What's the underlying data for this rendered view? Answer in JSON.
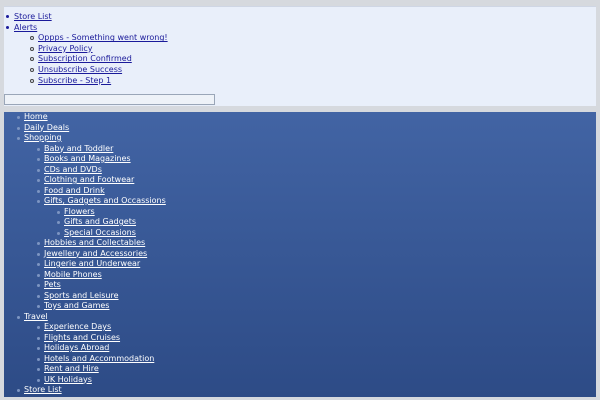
{
  "top_menu": {
    "items": [
      {
        "label": "Store List"
      },
      {
        "label": "Alerts",
        "children": [
          {
            "label": "Oppps - Something went wrong!"
          },
          {
            "label": "Privacy Policy"
          },
          {
            "label": "Subscription Confirmed"
          },
          {
            "label": "Unsubscribe Success"
          },
          {
            "label": "Subscribe - Step 1"
          }
        ]
      }
    ]
  },
  "search": {
    "value": "",
    "placeholder": ""
  },
  "nav": {
    "home": "Home",
    "daily_deals": "Daily Deals",
    "shopping": {
      "label": "Shopping",
      "items": [
        "Baby and Toddler",
        "Books and Magazines",
        "CDs and DVDs",
        "Clothing and Footwear",
        "Food and Drink",
        "Gifts, Gadgets and Occassions",
        "Hobbies and Collectables",
        "Jewellery and Accessories",
        "Lingerie and Underwear",
        "Mobile Phones",
        "Pets",
        "Sports and Leisure",
        "Toys and Games"
      ],
      "gifts_children": [
        "Flowers",
        "Gifts and Gadgets",
        "Special Occasions"
      ]
    },
    "travel": {
      "label": "Travel",
      "items": [
        "Experience Days",
        "Flights and Cruises",
        "Holidays Abroad",
        "Hotels and Accommodation",
        "Rent and Hire",
        "UK Holidays"
      ]
    },
    "store_list": "Store List"
  }
}
